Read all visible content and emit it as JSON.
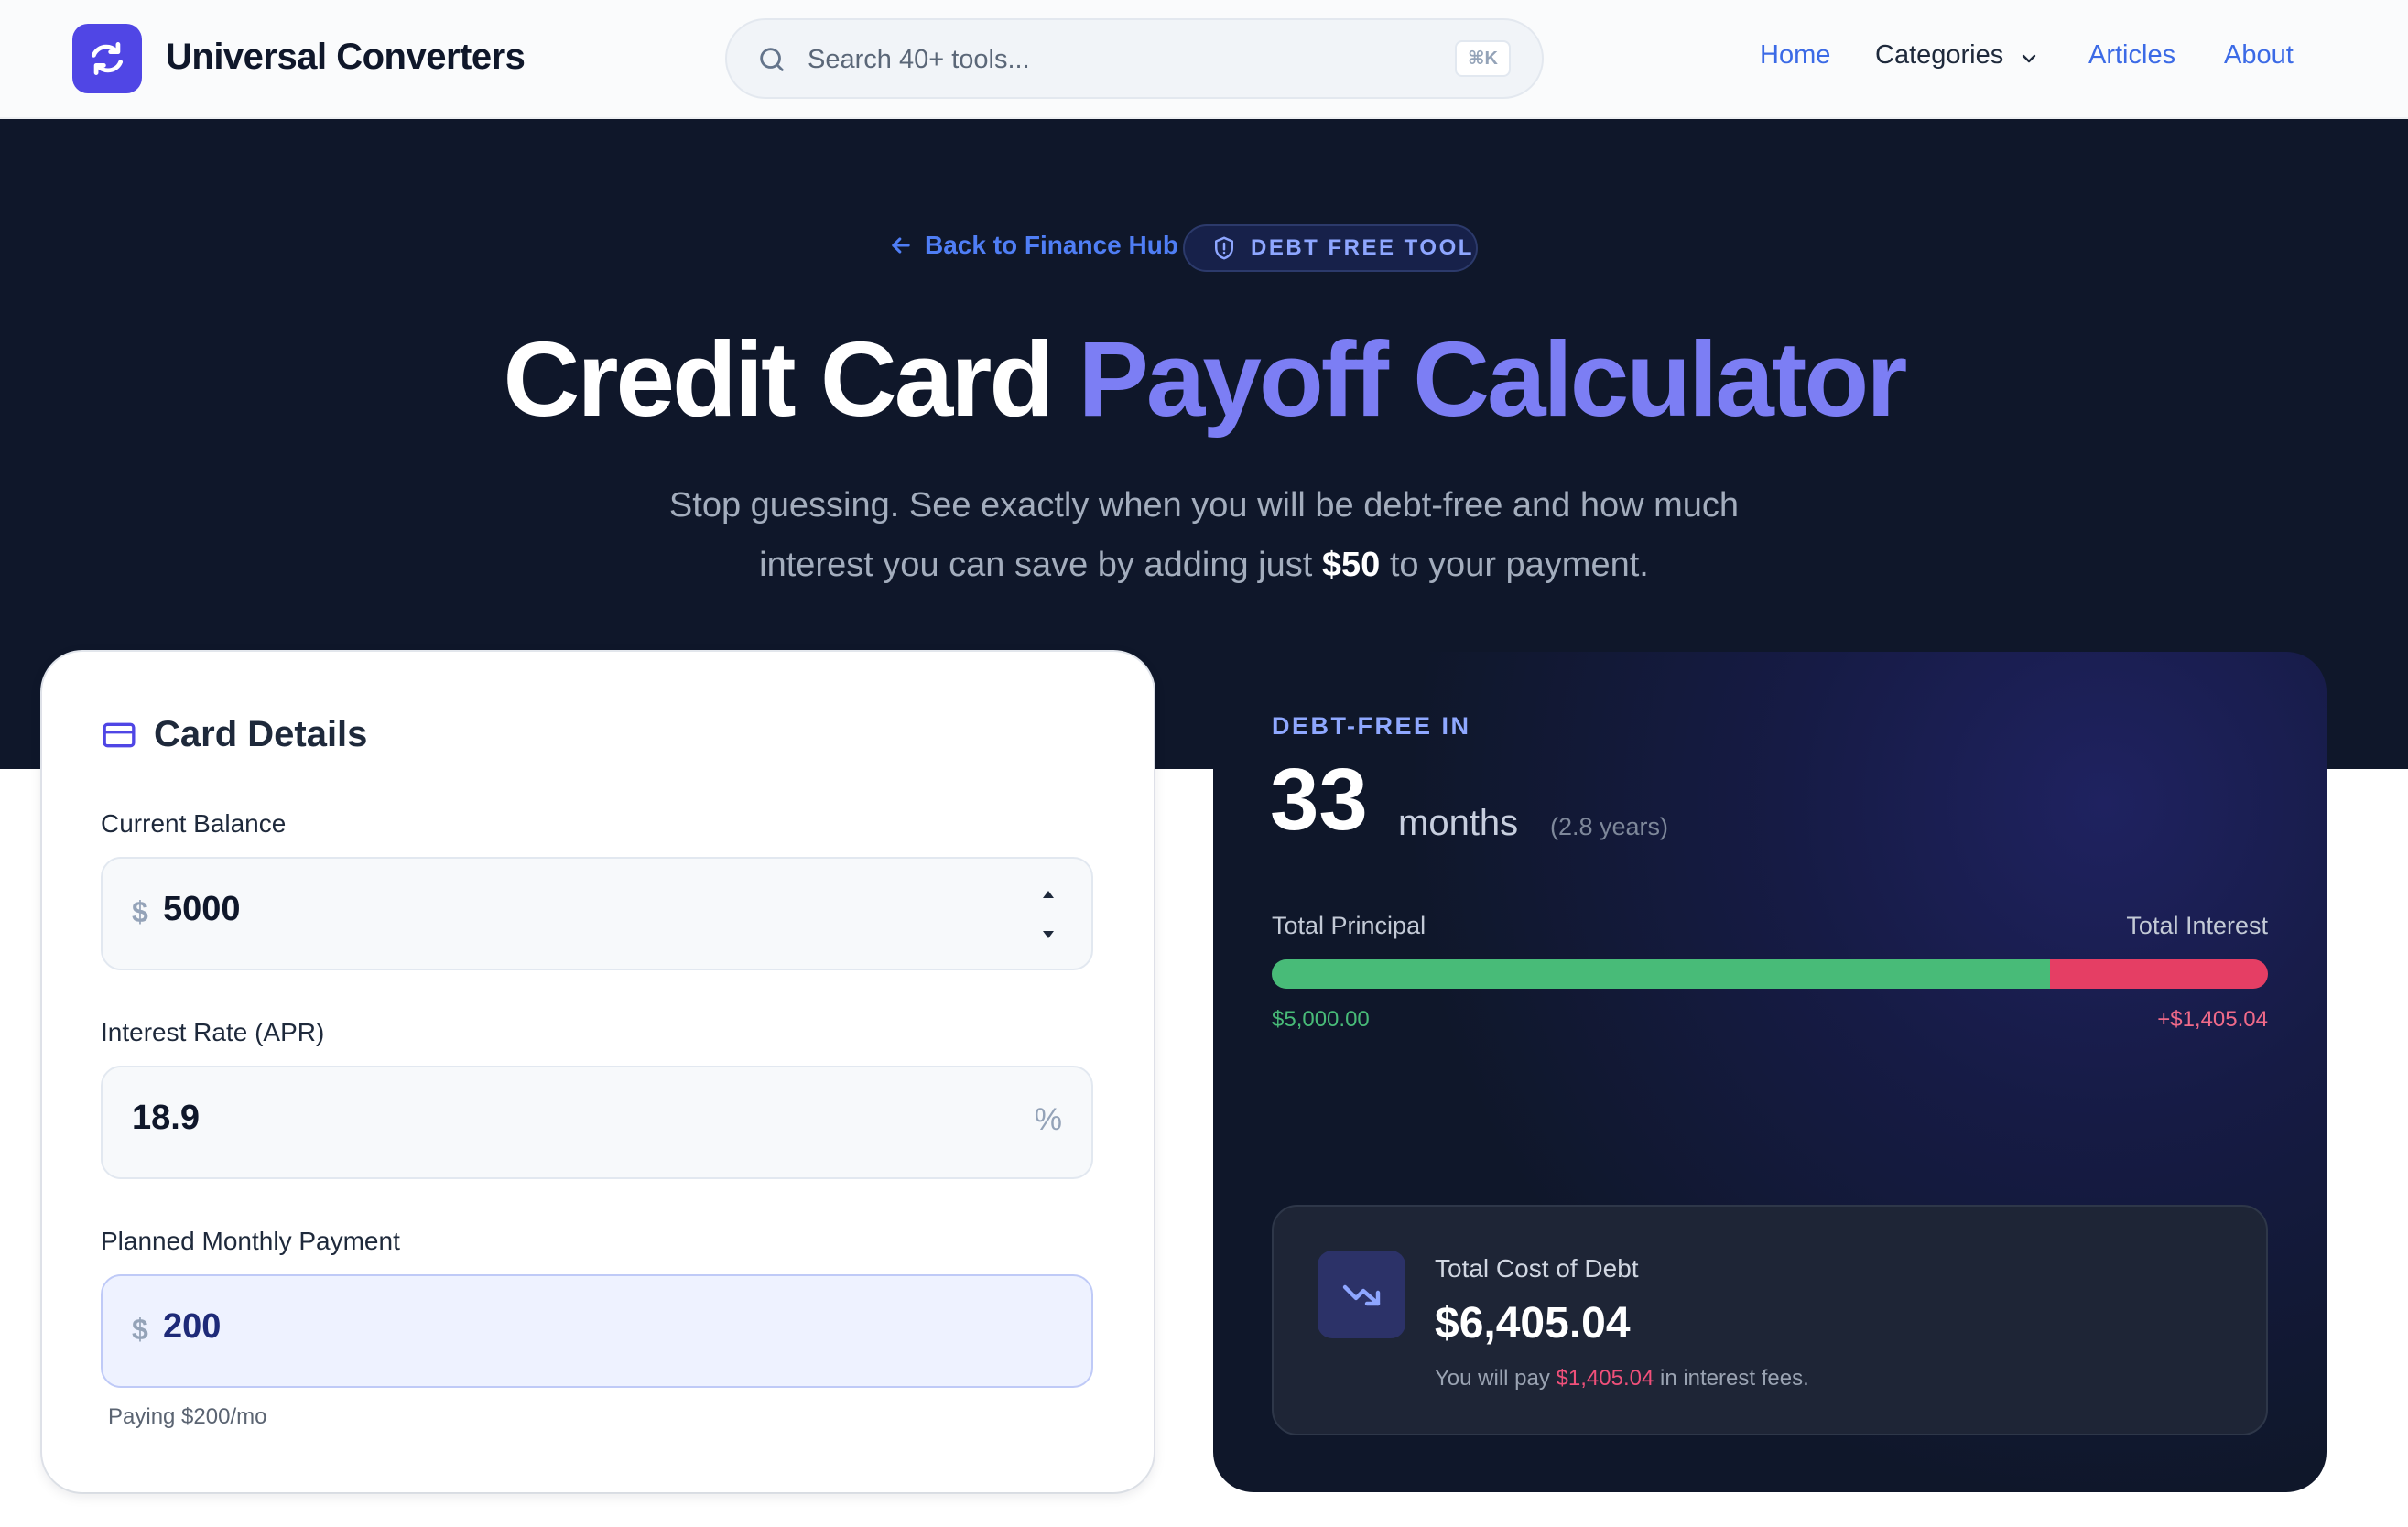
{
  "header": {
    "brand": "Universal Converters",
    "search_placeholder": "Search 40+ tools...",
    "search_shortcut": "⌘K",
    "nav": {
      "home": "Home",
      "categories": "Categories",
      "articles": "Articles",
      "about": "About"
    }
  },
  "hero": {
    "back_link": "Back to Finance Hub",
    "badge": "DEBT FREE TOOL",
    "title_plain": "Credit Card",
    "title_accent": "Payoff Calculator",
    "subtitle_line1": "Stop guessing. See exactly when you will be debt-free and how much",
    "subtitle_line2_pre": "interest you can save by adding just",
    "subtitle_highlight": "$50",
    "subtitle_line2_post": "to your payment."
  },
  "card_details": {
    "title": "Card Details",
    "balance": {
      "label": "Current Balance",
      "prefix": "$",
      "value": "5000"
    },
    "rate": {
      "label": "Interest Rate (APR)",
      "value": "18.9",
      "suffix": "%"
    },
    "payment": {
      "label": "Planned Monthly Payment",
      "prefix": "$",
      "value": "200",
      "hint": "Paying $200/mo"
    }
  },
  "results": {
    "eyebrow": "DEBT-FREE IN",
    "months": "33",
    "months_unit": "months",
    "years": "(2.8 years)",
    "principal_label": "Total Principal",
    "interest_label": "Total Interest",
    "principal_value": "$5,000.00",
    "interest_value": "+$1,405.04",
    "principal_fraction": 0.781,
    "total_cost_label": "Total Cost of Debt",
    "total_cost_value": "$6,405.04",
    "note_pre": "You will pay",
    "note_amount": "$1,405.04",
    "note_post": "in interest fees."
  },
  "colors": {
    "brand": "#5046e5",
    "accent": "#7c7ef4",
    "principal": "#48bb78",
    "interest": "#e53e64"
  },
  "icons": {
    "logo": "swap-arrows-icon",
    "search": "search-icon",
    "back": "arrow-left-icon",
    "badge": "shield-icon",
    "card": "credit-card-icon",
    "trend": "trending-down-icon"
  }
}
